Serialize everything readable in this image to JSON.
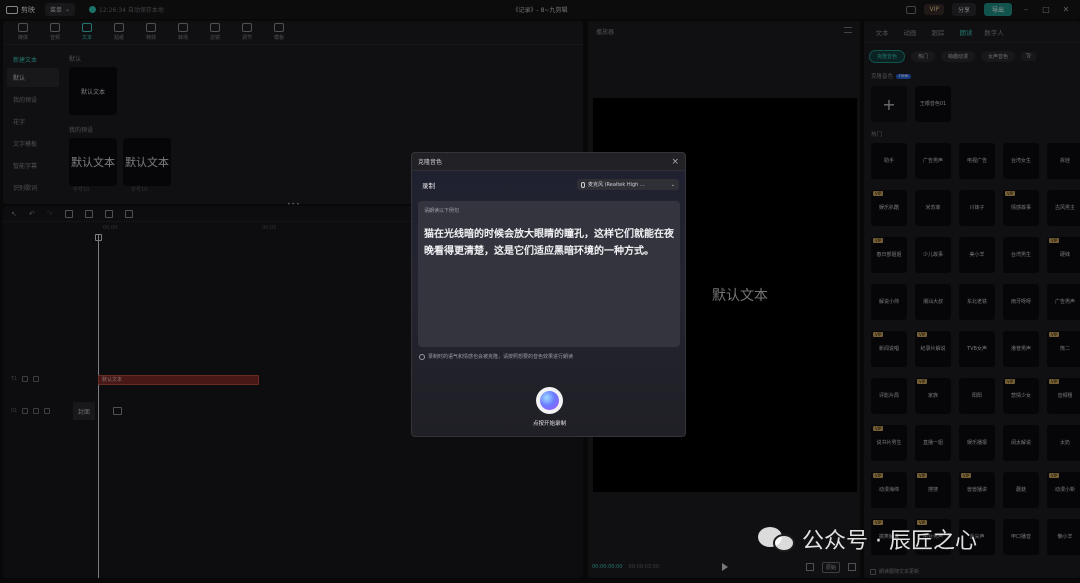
{
  "app": {
    "logo_text": "剪映",
    "menu_label": "菜单",
    "autosave": "12:26:34 自动保存本地",
    "title": "《记录》- 8~九剪辑",
    "vip_label": "VIP",
    "share_label": "分享",
    "export_label": "导出"
  },
  "media": {
    "tools": [
      "媒体",
      "音频",
      "文本",
      "贴纸",
      "特效",
      "转场",
      "滤镜",
      "调节",
      "模板"
    ],
    "active_tool": 2,
    "side_sub": "新建文本",
    "side_items": [
      "默认",
      "我的预设",
      "花字",
      "文字模板",
      "智能字幕",
      "识别歌词"
    ],
    "section_default": "默认",
    "default_card": "默认文本",
    "section_preset": "我的预设",
    "preset_cards": [
      "默认文本",
      "默认文本"
    ],
    "preset_meta": [
      "字号10",
      "字号10"
    ]
  },
  "timeline": {
    "ruler_start": "00:00",
    "ruler_mid": "00:05",
    "text_clip": "默认文本",
    "cover_label": "封面",
    "track_text_num": "T1",
    "track_video_num": "01"
  },
  "player": {
    "title": "播放器",
    "screen_text": "默认文本",
    "time_current": "00:00:00:00",
    "time_total": "00:00:03:00",
    "ratio_label": "原始"
  },
  "right_panel": {
    "tabs": [
      "文本",
      "动画",
      "跟踪",
      "朗读",
      "数字人"
    ],
    "active_tab": 3,
    "chips": [
      "克隆音色",
      "热门",
      "萌趣动漫",
      "女声音色"
    ],
    "chip_more": "Tr",
    "clone_label": "克隆音色",
    "new_badge": "new",
    "clone_voice": "王眼音色01",
    "hot_label": "热门",
    "voices": [
      {
        "name": "助手",
        "vip": false
      },
      {
        "name": "广告男声",
        "vip": false
      },
      {
        "name": "电视广告",
        "vip": false
      },
      {
        "name": "台湾女生",
        "vip": false
      },
      {
        "name": "拆娃",
        "vip": false
      },
      {
        "name": "娱乐扒酷",
        "vip": true
      },
      {
        "name": "米苏菲",
        "vip": false
      },
      {
        "name": "川妹子",
        "vip": false
      },
      {
        "name": "情感故事",
        "vip": true
      },
      {
        "name": "古风男主",
        "vip": false
      },
      {
        "name": "春日部姐姐",
        "vip": true
      },
      {
        "name": "少儿故事",
        "vip": false
      },
      {
        "name": "美小羊",
        "vip": false
      },
      {
        "name": "台湾男生",
        "vip": false
      },
      {
        "name": "硬妹",
        "vip": true
      },
      {
        "name": "解说小帅",
        "vip": false
      },
      {
        "name": "潮汕大叔",
        "vip": false
      },
      {
        "name": "东北老铁",
        "vip": false
      },
      {
        "name": "雨牙呀呀",
        "vip": false
      },
      {
        "name": "广告男声",
        "vip": false
      },
      {
        "name": "新闻说唱",
        "vip": true
      },
      {
        "name": "纪录片解说",
        "vip": true
      },
      {
        "name": "TVB女声",
        "vip": false
      },
      {
        "name": "港普男声",
        "vip": false
      },
      {
        "name": "熊二",
        "vip": true
      },
      {
        "name": "评影片局",
        "vip": false
      },
      {
        "name": "家族",
        "vip": true
      },
      {
        "name": "阳阳",
        "vip": false
      },
      {
        "name": "悲情少女",
        "vip": true
      },
      {
        "name": "音频粗",
        "vip": true
      },
      {
        "name": "说书片男生",
        "vip": true
      },
      {
        "name": "直播一姐",
        "vip": false
      },
      {
        "name": "娱乐播报",
        "vip": false
      },
      {
        "name": "阔太解说",
        "vip": false
      },
      {
        "name": "太奶",
        "vip": false
      },
      {
        "name": "动漫海绵",
        "vip": true
      },
      {
        "name": "搜搜",
        "vip": true
      },
      {
        "name": "兽兽播讲",
        "vip": true
      },
      {
        "name": "蘑菇",
        "vip": false
      },
      {
        "name": "动漫小新",
        "vip": true
      },
      {
        "name": "搞笑解说",
        "vip": true
      },
      {
        "name": "电台男声",
        "vip": true
      },
      {
        "name": "舌尖声",
        "vip": false
      },
      {
        "name": "甲口播音",
        "vip": false
      },
      {
        "name": "懒小羊",
        "vip": false
      }
    ],
    "foot_label": "朗读跟随文本更新"
  },
  "dialog": {
    "title": "克隆音色",
    "record_label": "录制",
    "mic_name": "麦克风 (Realtek High ...",
    "script_hint": "请朗读以下例句",
    "script_text": "猫在光线暗的时候会放大眼睛的瞳孔，这样它们就能在夜晚看得更清楚，这是它们适应黑暗环境的一种方式。",
    "info": "录制时的语气和情感也会被克隆，请按照想要的音色效果进行朗读",
    "record_caption": "点按开始录制"
  },
  "watermark": {
    "text": "公众号 · 辰匠之心"
  }
}
